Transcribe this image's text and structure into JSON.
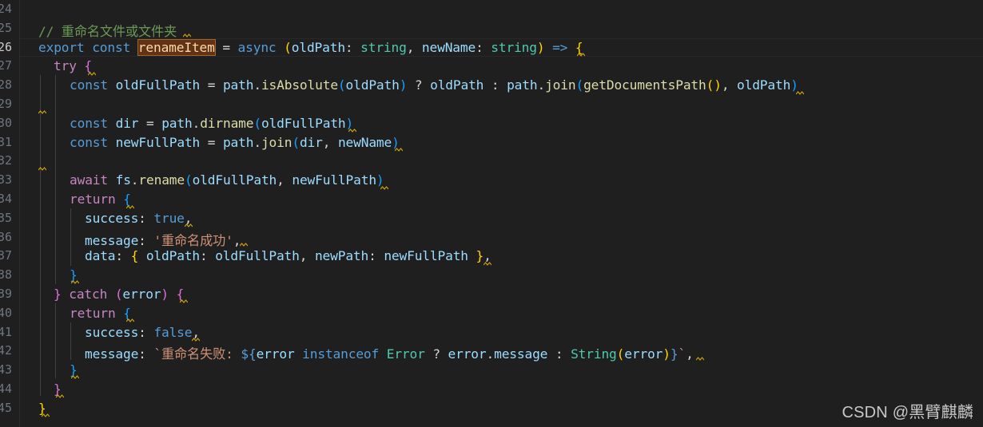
{
  "editor": {
    "language": "typescript",
    "theme": "dark",
    "current_line": "26",
    "highlighted_symbol": "renameItem"
  },
  "lines": [
    {
      "num": "24"
    },
    {
      "num": "25",
      "comment": "// 重命名文件或文件夹"
    },
    {
      "num": "26",
      "text": "export const renameItem = async (oldPath: string, newName: string) => {"
    },
    {
      "num": "27",
      "text": "try {"
    },
    {
      "num": "28",
      "text": "const oldFullPath = path.isAbsolute(oldPath) ? oldPath : path.join(getDocumentsPath(), oldPath)"
    },
    {
      "num": "29"
    },
    {
      "num": "30",
      "text": "const dir = path.dirname(oldFullPath)"
    },
    {
      "num": "31",
      "text": "const newFullPath = path.join(dir, newName)"
    },
    {
      "num": "32"
    },
    {
      "num": "33",
      "text": "await fs.rename(oldFullPath, newFullPath)"
    },
    {
      "num": "34",
      "text": "return {"
    },
    {
      "num": "35",
      "text": "success: true,"
    },
    {
      "num": "36",
      "text": "message: '重命名成功',"
    },
    {
      "num": "37",
      "text": "data: { oldPath: oldFullPath, newPath: newFullPath },"
    },
    {
      "num": "38",
      "text": "}"
    },
    {
      "num": "39",
      "text": "} catch (error) {"
    },
    {
      "num": "40",
      "text": "return {"
    },
    {
      "num": "41",
      "text": "success: false,"
    },
    {
      "num": "42",
      "text": "message: `重命名失败: ${error instanceof Error ? error.message : String(error)}`,"
    },
    {
      "num": "43",
      "text": "}"
    },
    {
      "num": "44",
      "text": "}"
    },
    {
      "num": "45",
      "text": "}"
    }
  ],
  "watermark": "CSDN @黑臂麒麟",
  "colors": {
    "background": "#1f1f1f",
    "keyword": "#569cd6",
    "control": "#c586c0",
    "function": "#dcdcaa",
    "variable": "#9cdcfe",
    "type": "#4ec9b0",
    "string": "#ce9178",
    "comment": "#6a9955",
    "bracket_1": "#ffd700",
    "bracket_2": "#da70d6",
    "bracket_3": "#179fff",
    "warning_squiggle": "#cca700",
    "line_number": "#6e7681"
  }
}
